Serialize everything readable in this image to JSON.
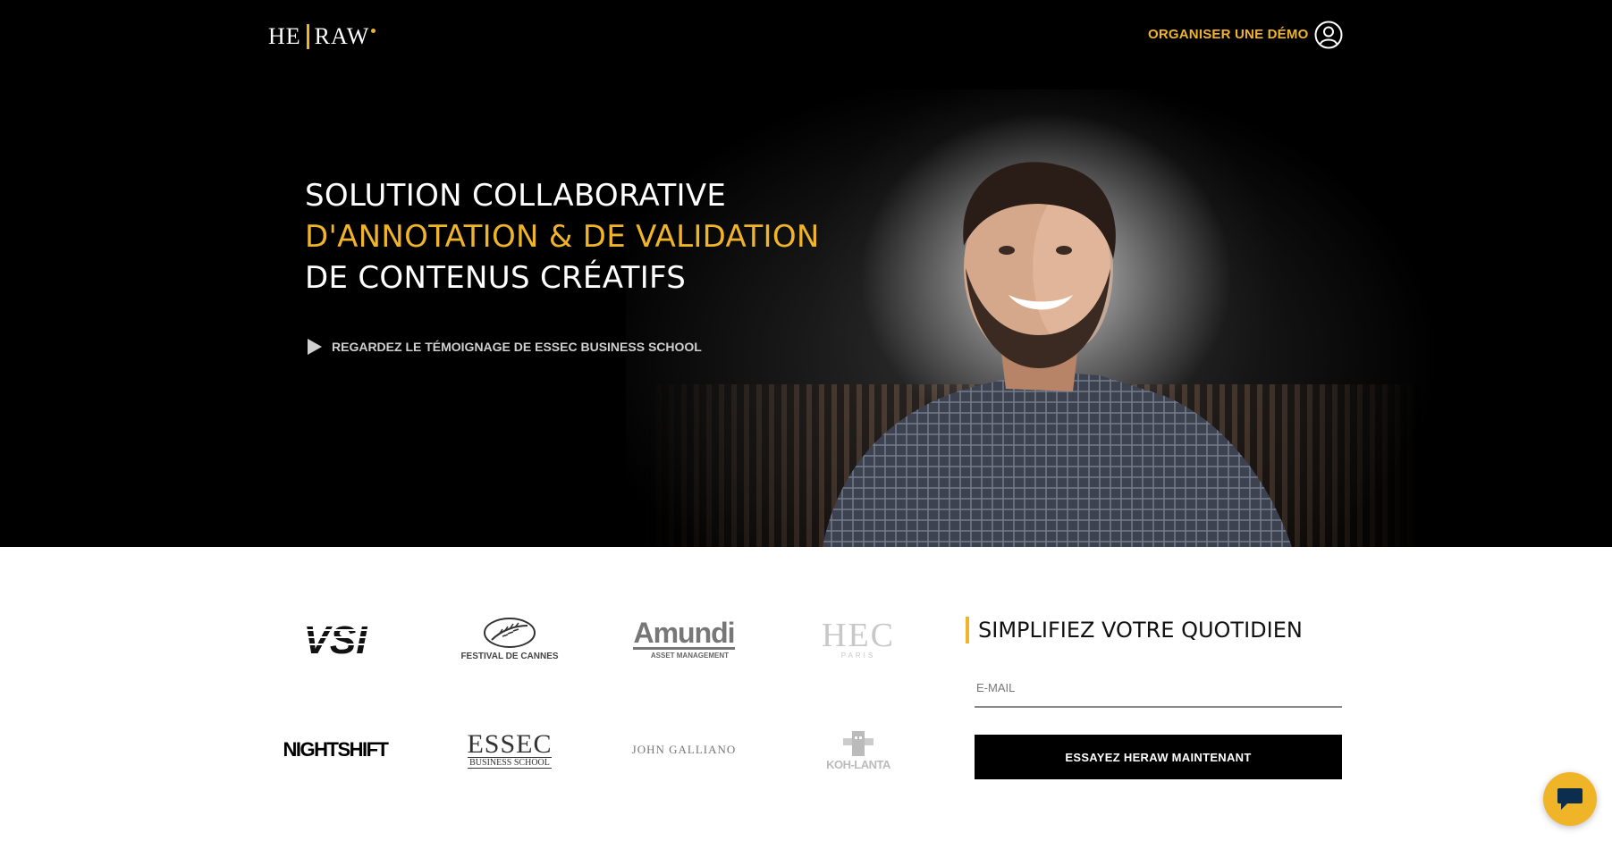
{
  "header": {
    "logo_left": "HE",
    "logo_right": "RAW",
    "demo_link": "ORGANISER UNE DÉMO",
    "user_icon": "user-circle-icon"
  },
  "hero": {
    "line1": "SOLUTION COLLABORATIVE",
    "line2": "D'ANNOTATION & DE VALIDATION",
    "line3": "DE CONTENUS CRÉATIFS",
    "watch_label": "REGARDEZ LE TÉMOIGNAGE DE ESSEC BUSINESS SCHOOL",
    "play_icon": "play-icon"
  },
  "clients": {
    "logos": [
      {
        "name": "VSI",
        "text": "VSI"
      },
      {
        "name": "Festival de Cannes",
        "text": "FESTIVAL DE CANNES"
      },
      {
        "name": "Amundi",
        "text": "Amundi",
        "sub": "ASSET MANAGEMENT"
      },
      {
        "name": "HEC Paris",
        "text": "HEC",
        "sub": "PARIS"
      },
      {
        "name": "Nightshift",
        "text": "NIGHTSHIFT"
      },
      {
        "name": "ESSEC",
        "text": "ESSEC",
        "sub": "BUSINESS SCHOOL"
      },
      {
        "name": "John Galliano",
        "text": "JOHN GALLIANO"
      },
      {
        "name": "Koh-Lanta",
        "text": "KOH-LANTA"
      }
    ]
  },
  "cta": {
    "title": "SIMPLIFIEZ VOTRE QUOTIDIEN",
    "email_placeholder": "E-MAIL",
    "button": "ESSAYEZ HERAW MAINTENANT"
  },
  "chat": {
    "icon": "chat-bubble-icon"
  },
  "colors": {
    "accent": "#f0b429",
    "hero_bg": "#000000"
  }
}
